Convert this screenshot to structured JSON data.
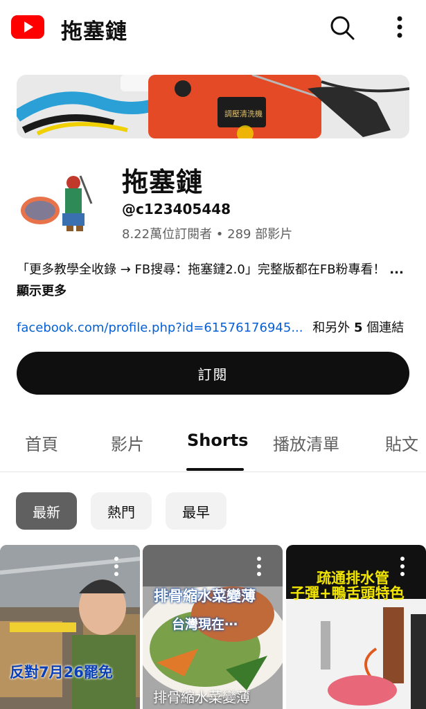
{
  "header": {
    "title": "拖塞鏈",
    "logo_icon": "youtube-logo",
    "search_icon": "search-icon",
    "more_icon": "more-vert-icon"
  },
  "channel": {
    "name": "拖塞鏈",
    "handle": "@c123405448",
    "stats": "8.22萬位訂閱者 • 289 部影片",
    "description": "「更多教學全收錄 → FB搜尋：拖塞鏈2.0」完整版都在FB粉專看！",
    "description_more": "...顯示更多",
    "link_url": "facebook.com/profile.php?id=61576176945...",
    "link_more_prefix": "和另外",
    "link_more_count": "5",
    "link_more_suffix": "個連結",
    "subscribe_label": "訂閱",
    "banner_label": "調壓清洗機"
  },
  "tabs": [
    {
      "label": "首頁",
      "active": false
    },
    {
      "label": "影片",
      "active": false
    },
    {
      "label": "Shorts",
      "active": true
    },
    {
      "label": "播放清單",
      "active": false
    },
    {
      "label": "貼文",
      "active": false
    }
  ],
  "chips": [
    {
      "label": "最新",
      "active": true
    },
    {
      "label": "熱門",
      "active": false
    },
    {
      "label": "最早",
      "active": false
    }
  ],
  "shorts": [
    {
      "overlay": "反對7月26罷免",
      "caption": ""
    },
    {
      "overlay_top": "排骨縮水菜變薄",
      "overlay_mid": "台灣現在⋯",
      "caption": "排骨縮水菜變薄"
    },
    {
      "overlay_top": "疏通排水管",
      "overlay_mid": "子彈+鴨舌頭特色",
      "caption": ""
    }
  ],
  "colors": {
    "accent": "#ff0000",
    "link": "#065fd4",
    "text": "#0f0f0f",
    "secondary": "#606060"
  }
}
